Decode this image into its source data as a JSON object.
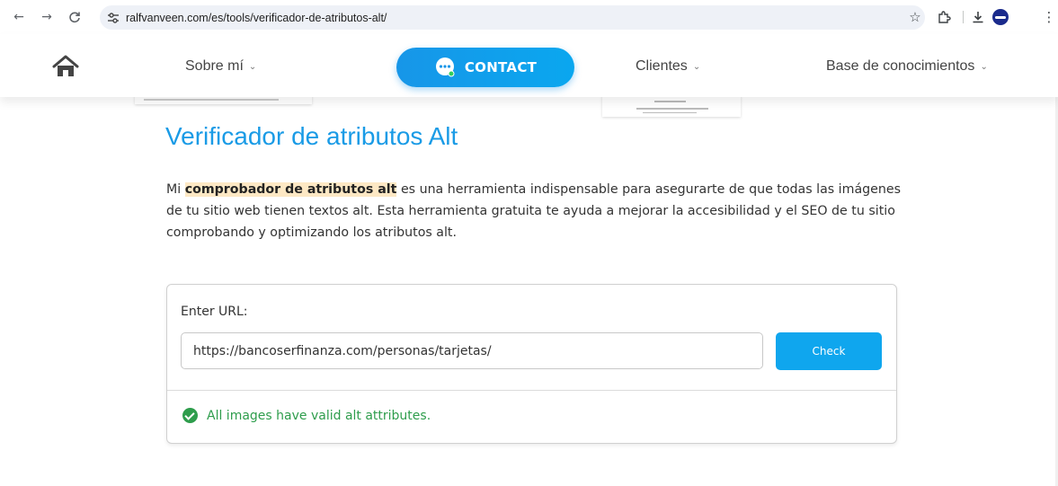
{
  "browser": {
    "url": "ralfvanveen.com/es/tools/verificador-de-atributos-alt/",
    "icons": {
      "back": "arrow-left-icon",
      "forward": "arrow-right-icon",
      "reload": "reload-icon",
      "site_info": "tune-icon",
      "bookmark": "star-icon",
      "extensions": "puzzle-icon",
      "downloads": "download-icon",
      "menu": "kebab-menu-icon"
    }
  },
  "header": {
    "nav": [
      {
        "label": "Sobre mí"
      },
      {
        "label": "Clientes"
      },
      {
        "label": "Base de conocimientos"
      }
    ],
    "contact_label": "CONTACT",
    "accent": "#0aa7ef"
  },
  "main": {
    "title": "Verificador de atributos Alt",
    "intro_prefix": "Mi ",
    "intro_highlight": "comprobador de atributos alt",
    "intro_rest": " es una herramienta indispensable para asegurarte de que todas las imágenes de tu sitio web tienen textos alt. Esta herramienta gratuita te ayuda a mejorar la accesibilidad y el SEO de tu sitio comprobando y optimizando los atributos alt."
  },
  "tool": {
    "label": "Enter URL:",
    "input_value": "https://bancoserfinanza.com/personas/tarjetas/",
    "button_label": "Check",
    "result": "All images have valid alt attributes.",
    "result_color": "#2e9d4c"
  }
}
